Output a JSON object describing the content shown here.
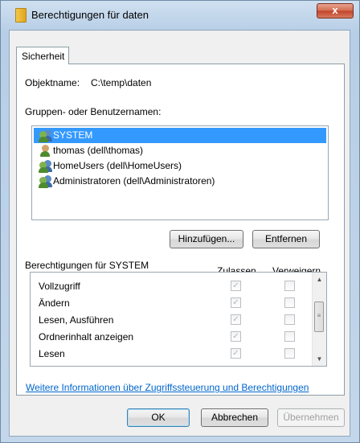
{
  "window": {
    "title": "Berechtigungen für daten",
    "close_glyph": "x"
  },
  "tabs": [
    {
      "label": "Sicherheit"
    }
  ],
  "object": {
    "label": "Objektname:",
    "value": "C:\\temp\\daten"
  },
  "groups": {
    "label": "Gruppen- oder Benutzernamen:",
    "items": [
      {
        "label": "SYSTEM",
        "icon": "group-icon",
        "selected": true
      },
      {
        "label": "thomas (dell\\thomas)",
        "icon": "user-icon",
        "selected": false
      },
      {
        "label": "HomeUsers (dell\\HomeUsers)",
        "icon": "group-icon",
        "selected": false
      },
      {
        "label": "Administratoren (dell\\Administratoren)",
        "icon": "group-icon",
        "selected": false
      }
    ],
    "add_label": "Hinzufügen...",
    "remove_label": "Entfernen"
  },
  "permissions": {
    "header": "Berechtigungen für SYSTEM",
    "allow_header": "Zulassen",
    "deny_header": "Verweigern",
    "rows": [
      {
        "label": "Vollzugriff",
        "allow": true,
        "deny": false
      },
      {
        "label": "Ändern",
        "allow": true,
        "deny": false
      },
      {
        "label": "Lesen, Ausführen",
        "allow": true,
        "deny": false
      },
      {
        "label": "Ordnerinhalt anzeigen",
        "allow": true,
        "deny": false
      },
      {
        "label": "Lesen",
        "allow": true,
        "deny": false
      }
    ]
  },
  "info_link": "Weitere Informationen über Zugriffssteuerung und Berechtigungen",
  "footer": {
    "ok": "OK",
    "cancel": "Abbrechen",
    "apply": "Übernehmen"
  },
  "colors": {
    "selection": "#3399ff",
    "link": "#0066cc",
    "close_button": "#c0432a"
  }
}
